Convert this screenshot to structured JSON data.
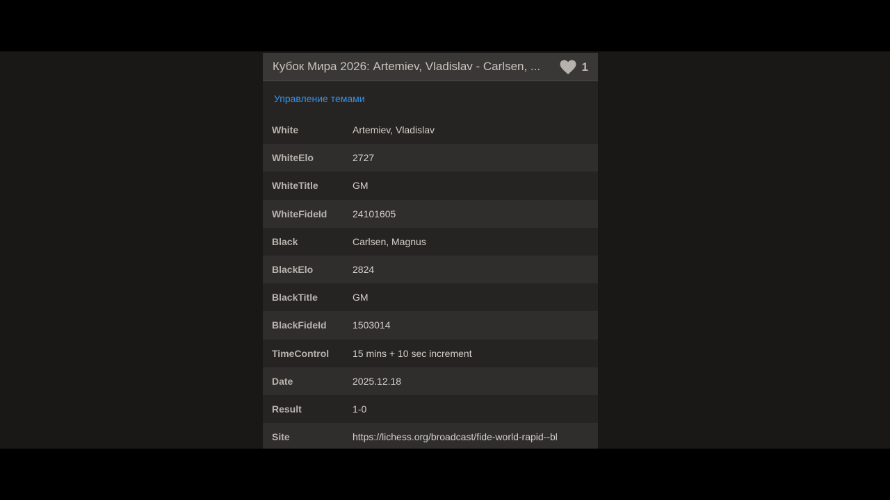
{
  "header": {
    "title": "Кубок Мира 2026: Artemiev, Vladislav - Carlsen, ...",
    "like_count": "1",
    "like_icon": "heart-icon"
  },
  "manage_link": "Управление темами",
  "tags": [
    {
      "key": "White",
      "value": "Artemiev, Vladislav"
    },
    {
      "key": "WhiteElo",
      "value": "2727"
    },
    {
      "key": "WhiteTitle",
      "value": "GM"
    },
    {
      "key": "WhiteFideId",
      "value": "24101605"
    },
    {
      "key": "Black",
      "value": "Carlsen, Magnus"
    },
    {
      "key": "BlackElo",
      "value": "2824"
    },
    {
      "key": "BlackTitle",
      "value": "GM"
    },
    {
      "key": "BlackFideId",
      "value": "1503014"
    },
    {
      "key": "TimeControl",
      "value": "15 mins + 10 sec increment"
    },
    {
      "key": "Date",
      "value": "2025.12.18"
    },
    {
      "key": "Result",
      "value": "1-0"
    },
    {
      "key": "Site",
      "value": "https://lichess.org/broadcast/fide-world-rapid--bl"
    }
  ],
  "colors": {
    "accent": "#d85e1f",
    "link": "#3692e7",
    "panel_bg": "#262422",
    "header_bg": "#3a3836"
  }
}
